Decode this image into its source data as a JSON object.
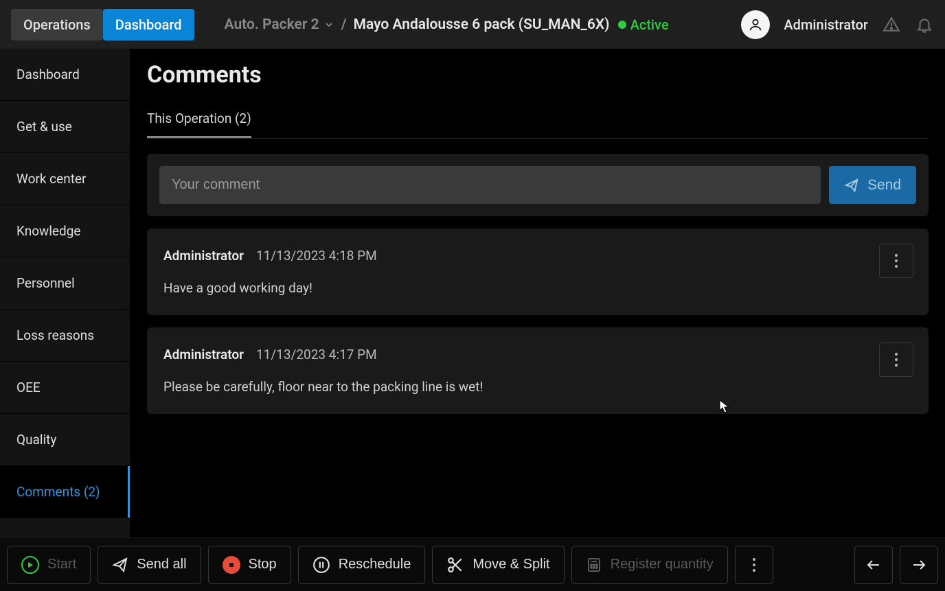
{
  "topbar": {
    "tabs": {
      "operations": "Operations",
      "dashboard": "Dashboard"
    },
    "breadcrumb": {
      "machine": "Auto. Packer 2",
      "separator": "/",
      "product": "Mayo Andalousse 6 pack (SU_MAN_6X)"
    },
    "status": "Active",
    "user": "Administrator"
  },
  "sidebar": {
    "items": [
      {
        "label": "Dashboard"
      },
      {
        "label": "Get & use"
      },
      {
        "label": "Work center"
      },
      {
        "label": "Knowledge"
      },
      {
        "label": "Personnel"
      },
      {
        "label": "Loss reasons"
      },
      {
        "label": "OEE"
      },
      {
        "label": "Quality"
      },
      {
        "label": "Comments (2)"
      }
    ]
  },
  "page": {
    "title": "Comments",
    "tab": "This Operation (2)",
    "input_placeholder": "Your comment",
    "send_label": "Send"
  },
  "comments": [
    {
      "author": "Administrator",
      "time": "11/13/2023 4:18 PM",
      "body": "Have a good working day!"
    },
    {
      "author": "Administrator",
      "time": "11/13/2023 4:17 PM",
      "body": "Please be carefully, floor near to the packing line is wet!"
    }
  ],
  "actions": {
    "start": "Start",
    "send_all": "Send all",
    "stop": "Stop",
    "reschedule": "Reschedule",
    "move_split": "Move & Split",
    "register_qty": "Register quantity"
  }
}
